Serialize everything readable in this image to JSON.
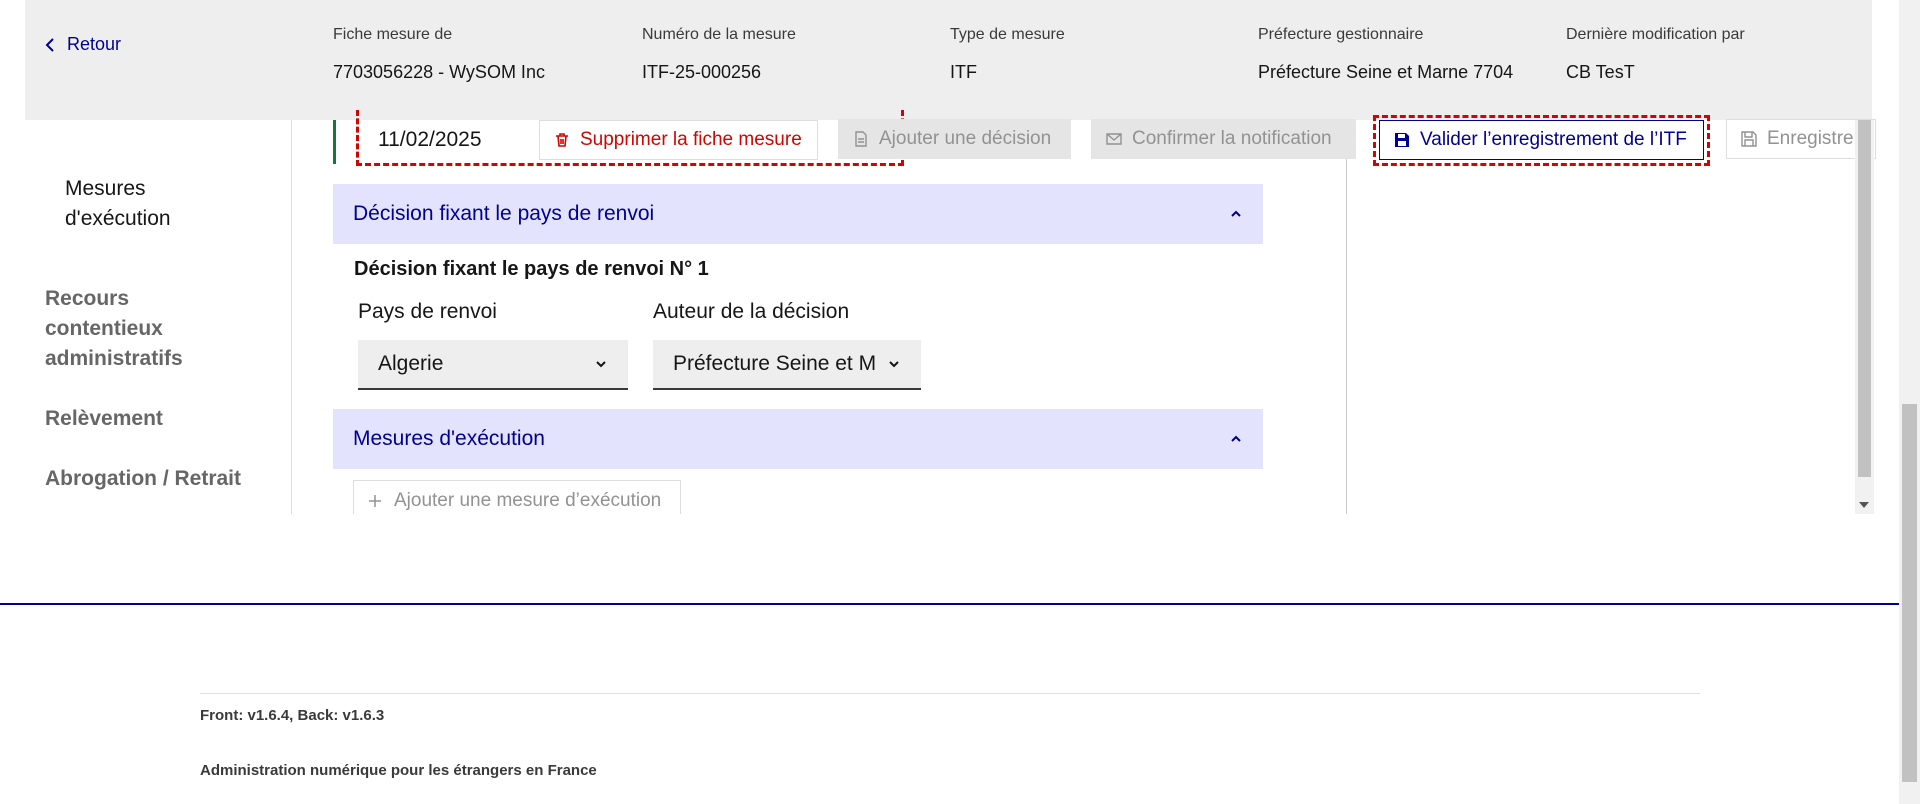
{
  "header": {
    "back_label": "Retour",
    "fields": [
      {
        "label": "Fiche mesure de",
        "value": "7703056228 - WySOM Inc"
      },
      {
        "label": "Numéro de la mesure",
        "value": "ITF-25-000256"
      },
      {
        "label": "Type de mesure",
        "value": "ITF"
      },
      {
        "label": "Préfecture gestionnaire",
        "value": "Préfecture Seine et Marne 7704"
      },
      {
        "label": "Dernière modification par",
        "value": "CB TesT"
      }
    ]
  },
  "sidebar": {
    "items": [
      {
        "label": "Mesures d'exécution",
        "active": true
      },
      {
        "label": "Recours contentieux administratifs",
        "active": false
      },
      {
        "label": "Relèvement",
        "active": false
      },
      {
        "label": "Abrogation / Retrait",
        "active": false
      }
    ]
  },
  "toolbar": {
    "date_value": "11/02/2025",
    "delete_label": "Supprimer la fiche mesure",
    "add_decision_label": "Ajouter une décision",
    "confirm_label": "Confirmer la notification",
    "validate_label": "Valider l’enregistrement de l’ITF",
    "save_label": "Enregistrer"
  },
  "sections": {
    "decision": {
      "title": "Décision fixant le pays de renvoi",
      "subtitle": "Décision fixant le pays de renvoi N° 1",
      "country_label": "Pays de renvoi",
      "country_value": "Algerie",
      "author_label": "Auteur de la décision",
      "author_value": "Préfecture Seine et M"
    },
    "measures": {
      "title": "Mesures d'exécution",
      "add_label": "Ajouter une mesure d’exécution"
    }
  },
  "footer": {
    "version": "Front: v1.6.4, Back: v1.6.3",
    "admin": "Administration numérique pour les étrangers en France"
  },
  "colors": {
    "primary": "#000091",
    "danger": "#ce0500",
    "accordion_bg": "#e3e3fd",
    "header_bg": "#eeeeee",
    "success": "#18753c"
  }
}
